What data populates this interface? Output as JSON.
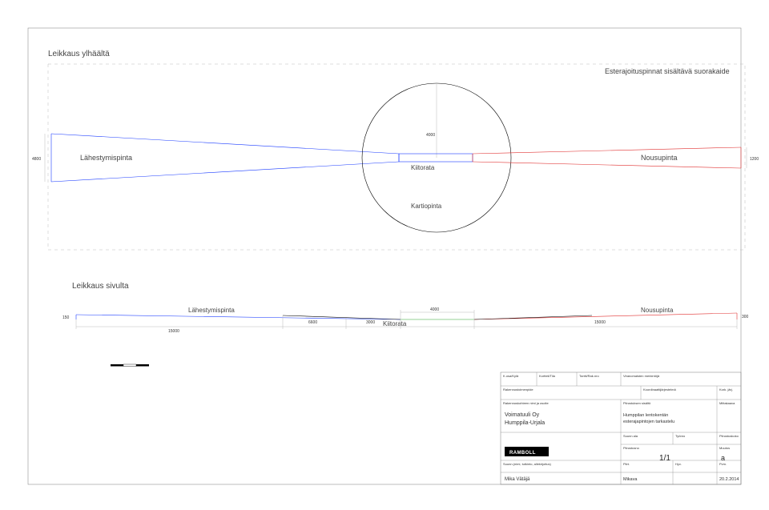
{
  "frame": {
    "title": ""
  },
  "top_view": {
    "title": "Leikkaus ylhäältä",
    "note": "Esterajoituspinnat sisältävä suorakaide",
    "approach_label": "Lähestymispinta",
    "runway_label": "Kiitorata",
    "cone_label": "Kartiopinta",
    "climb_label": "Nousupinta",
    "left_end_dim": "4800",
    "right_end_dim": "1200",
    "radius_dim": "4000"
  },
  "side_view": {
    "title": "Leikkaus sivulta",
    "approach_label": "Lähestymispinta",
    "runway_label": "Kiitorata",
    "climb_label": "Nousupinta",
    "left_height": "150",
    "right_height": "300",
    "dim_15000_a": "15000",
    "dim_6600": "6600",
    "dim_3000": "3000",
    "dim_4000": "4000",
    "dim_15000_b": "15000"
  },
  "titleblock": {
    "labels": {
      "kosa_kyla": "K.osa/Kylä",
      "kortteli_tila": "Kortteli/Tila",
      "tontti_rakno": "Tontti/Rak.nro",
      "viranomaisten_merkintoja": "Viranomaisten merkintöjä",
      "rakennustoimenpide": "Rakennustoimenpide",
      "koordinaatti": "Koordinaattijärjestelmä",
      "kork_jarj": "Kork. järj.",
      "rakennuskohteen": "Rakennuskohteen nimi ja osoite",
      "piirustuksen_sisalto": "Piirustuksen sisältö",
      "mittakaava": "Mittakaava",
      "suunn_ala": "Suunn ala",
      "tyono": "Työnro",
      "piirustuskoko": "Piirustuskoko",
      "piirustusno": "Piirustusno",
      "muutos": "Muutos",
      "suunn_nimi": "Suunn.(nimi, tutkinto, allekirjoitus)",
      "piirt": "Piirt.",
      "hyv": "Hyv.",
      "pvm": "Pvm."
    },
    "values": {
      "company": "Voimatuuli Oy",
      "site": "Humppila-Urjala",
      "content1": "Humppilan lentokentän",
      "content2": "esterajapintojen tarkastelu",
      "logo": "RAMBOLL",
      "sheet": "1/1",
      "revision": "a",
      "designer": "Mika Vätäjä",
      "piirt": "Mikava",
      "date": "20.2.2014"
    }
  }
}
